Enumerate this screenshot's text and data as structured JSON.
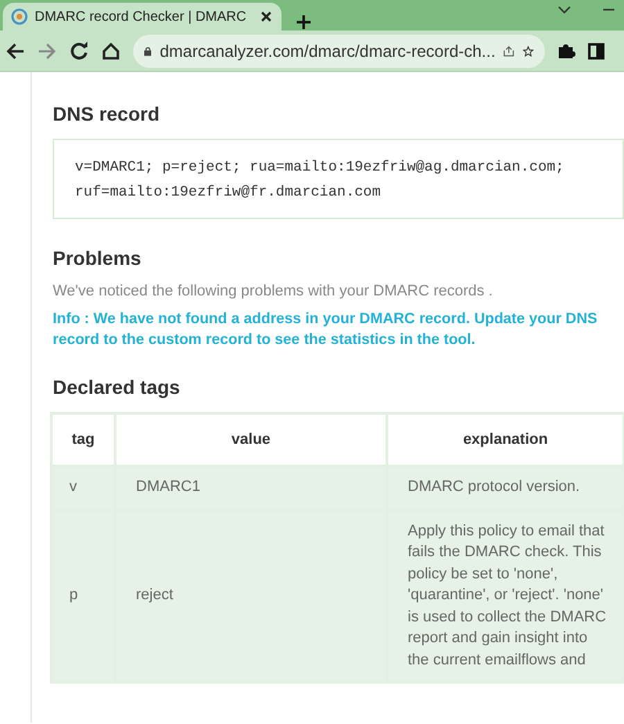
{
  "browser": {
    "tab_title": "DMARC record Checker | DMARC",
    "address": "dmarcanalyzer.com/dmarc/dmarc-record-ch..."
  },
  "dns_record": {
    "heading": "DNS record",
    "lines": [
      "v=DMARC1; p=reject; rua=mailto:19ezfriw@ag.dmarcian.com;",
      "ruf=mailto:19ezfriw@fr.dmarcian.com"
    ]
  },
  "problems": {
    "heading": "Problems",
    "intro": "We've noticed the following problems with your DMARC records .",
    "info": "Info : We have not found a address in your DMARC record. Update your DNS record to the custom record to see the statistics in the tool."
  },
  "declared_tags": {
    "heading": "Declared tags",
    "columns": [
      "tag",
      "value",
      "explanation"
    ],
    "rows": [
      {
        "tag": "v",
        "value": "DMARC1",
        "explanation": "DMARC protocol version."
      },
      {
        "tag": "p",
        "value": "reject",
        "explanation": "Apply this policy to email that fails the DMARC check. This policy be set to 'none', 'quarantine', or 'reject'. 'none' is used to collect the DMARC report and gain insight into the current emailflows and"
      }
    ]
  }
}
